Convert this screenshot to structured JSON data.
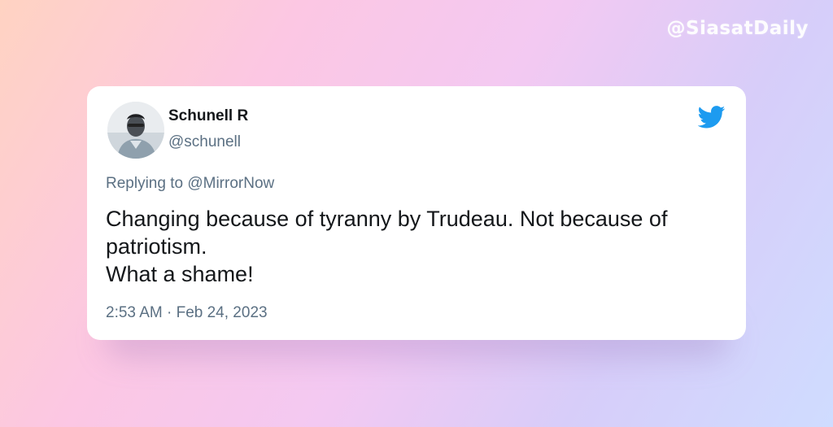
{
  "watermark": "@SiasatDaily",
  "tweet": {
    "author": {
      "display_name": "Schunell R",
      "handle": "@schunell",
      "avatar_icon": "user-avatar-photo"
    },
    "reply": {
      "prefix": "Replying to",
      "mention": "@MirrorNow"
    },
    "text_lines": [
      "Changing because of tyranny by Trudeau. Not because of",
      "patriotism.",
      "What a shame!"
    ],
    "timestamp": "2:53 AM · Feb 24, 2023",
    "brand_icon": "twitter-bird-icon"
  },
  "colors": {
    "twitter_blue": "#1d9bf0",
    "text_primary": "#14171a",
    "text_secondary": "#5b7083",
    "card_bg": "#ffffff"
  }
}
